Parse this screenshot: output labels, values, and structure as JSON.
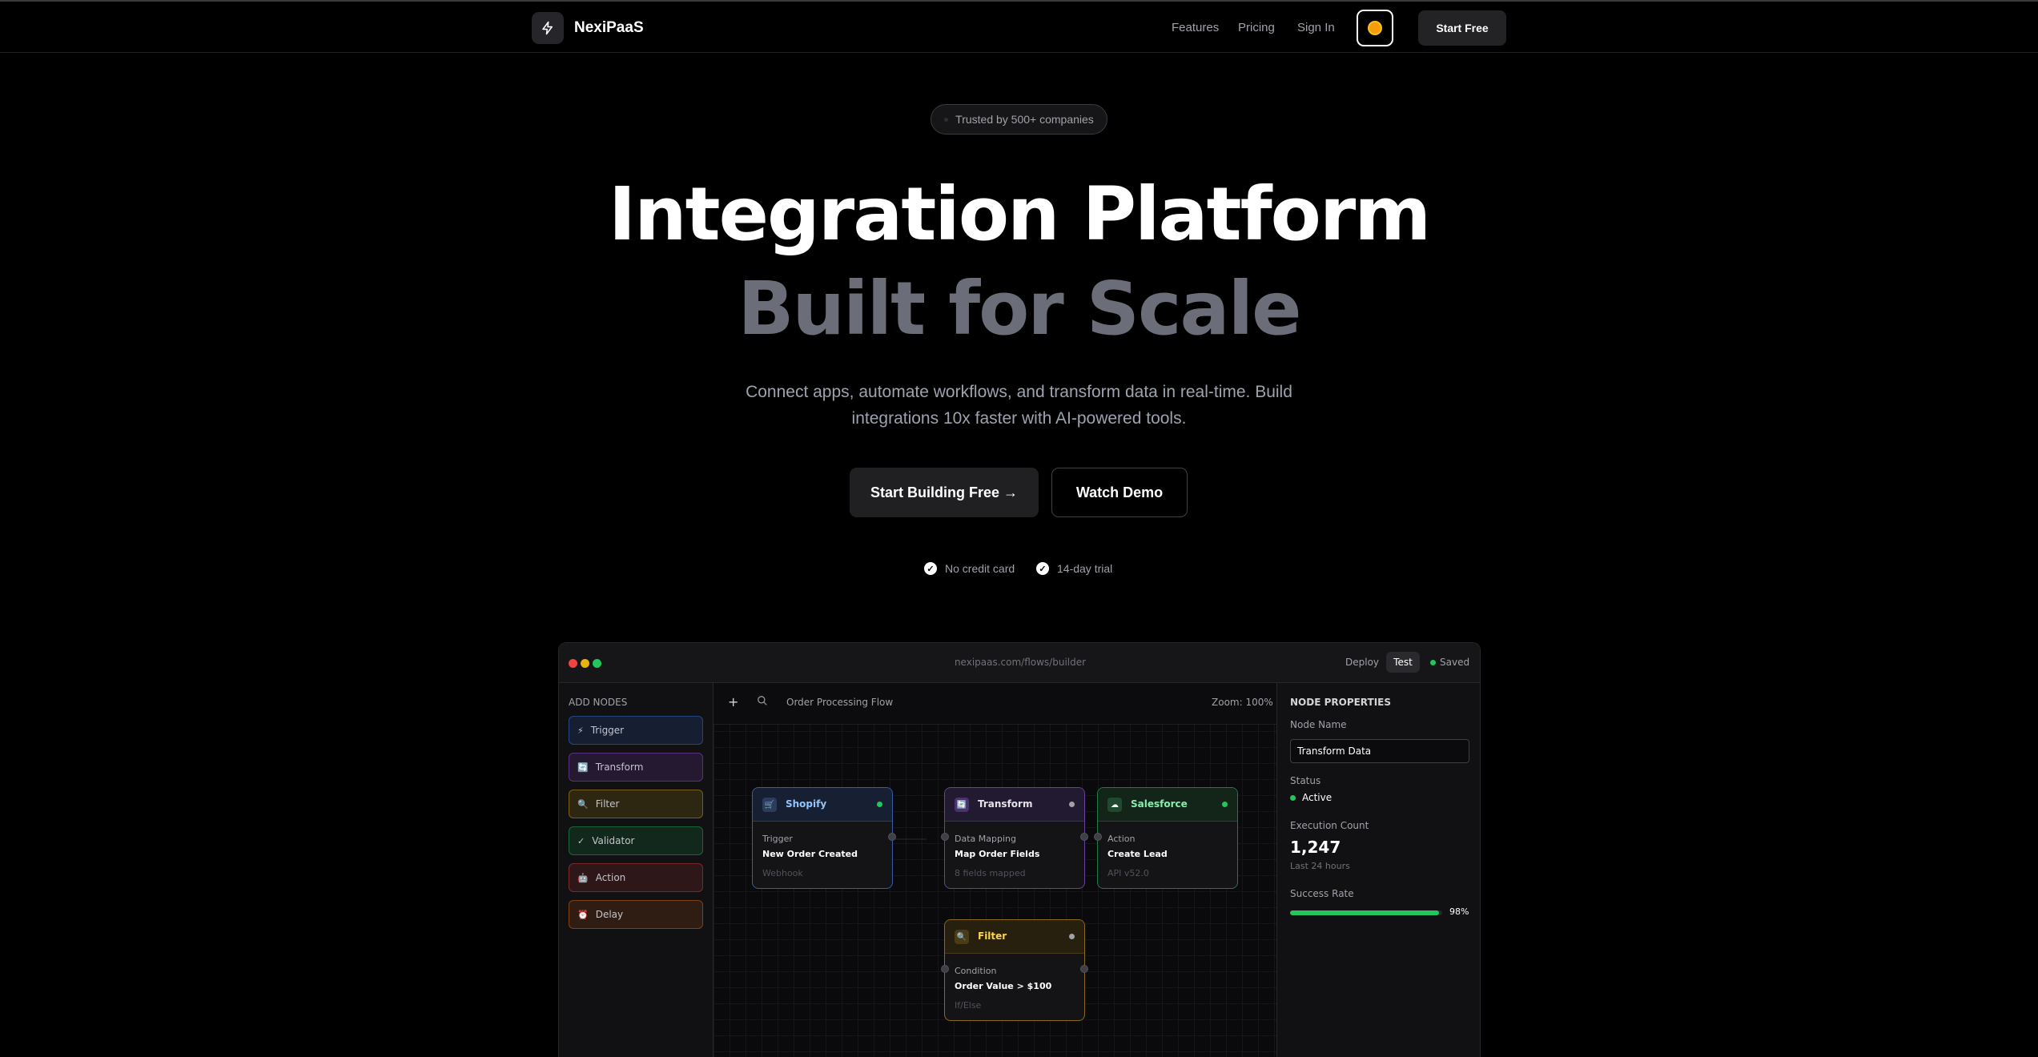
{
  "nav": {
    "brand": "NexiPaaS",
    "links": [
      "Features",
      "Pricing",
      "Sign In"
    ],
    "cta": "Start Free",
    "theme_icon": "sun-icon",
    "logo_icon": "lightning-icon"
  },
  "hero": {
    "badge": "Trusted by 500+ companies",
    "title_line1": "Integration Platform",
    "title_line2": "Built for Scale",
    "subtitle": "Connect apps, automate workflows, and transform data in real-time. Build integrations 10x faster with AI-powered tools.",
    "primary_button": "Start Building Free →",
    "secondary_button": "Watch Demo",
    "features": [
      "No credit card",
      "14-day trial"
    ]
  },
  "builder": {
    "url": "nexipaas.com/flows/builder",
    "deploy": "Deploy",
    "test": "Test",
    "saved": "Saved",
    "add_nodes_title": "ADD NODES",
    "palette": [
      {
        "label": "Trigger",
        "icon": "⚡",
        "color": "#3b82f6"
      },
      {
        "label": "Transform",
        "icon": "🔄",
        "color": "#a855f7"
      },
      {
        "label": "Filter",
        "icon": "🔍",
        "color": "#eab308"
      },
      {
        "label": "Validator",
        "icon": "✓",
        "color": "#22c55e"
      },
      {
        "label": "Action",
        "icon": "🤖",
        "color": "#ef4444"
      },
      {
        "label": "Delay",
        "icon": "⏰",
        "color": "#f97316"
      }
    ],
    "toolbar": {
      "add_icon": "+",
      "zoom_icon": "🔍",
      "flow_name": "Order Processing Flow",
      "zoom": "Zoom: 100%"
    },
    "nodes": {
      "shopify": {
        "title": "Shopify",
        "type": "Trigger",
        "value": "New Order Created",
        "meta": "Webhook",
        "icon": "🛒"
      },
      "transform": {
        "title": "Transform",
        "type": "Data Mapping",
        "value": "Map Order Fields",
        "meta": "8 fields mapped",
        "icon": "🔄"
      },
      "salesforce": {
        "title": "Salesforce",
        "type": "Action",
        "value": "Create Lead",
        "meta": "API v52.0",
        "icon": "☁"
      },
      "filter": {
        "title": "Filter",
        "type": "Condition",
        "value": "Order Value > $100",
        "meta": "If/Else",
        "icon": "🔍"
      }
    },
    "properties": {
      "title": "NODE PROPERTIES",
      "node_name_label": "Node Name",
      "node_name_value": "Transform Data",
      "status_label": "Status",
      "status_value": "Active",
      "exec_label": "Execution Count",
      "exec_value": "1,247",
      "exec_sub": "Last 24 hours",
      "success_label": "Success Rate",
      "success_value": "98%",
      "success_fraction": 0.98
    }
  }
}
